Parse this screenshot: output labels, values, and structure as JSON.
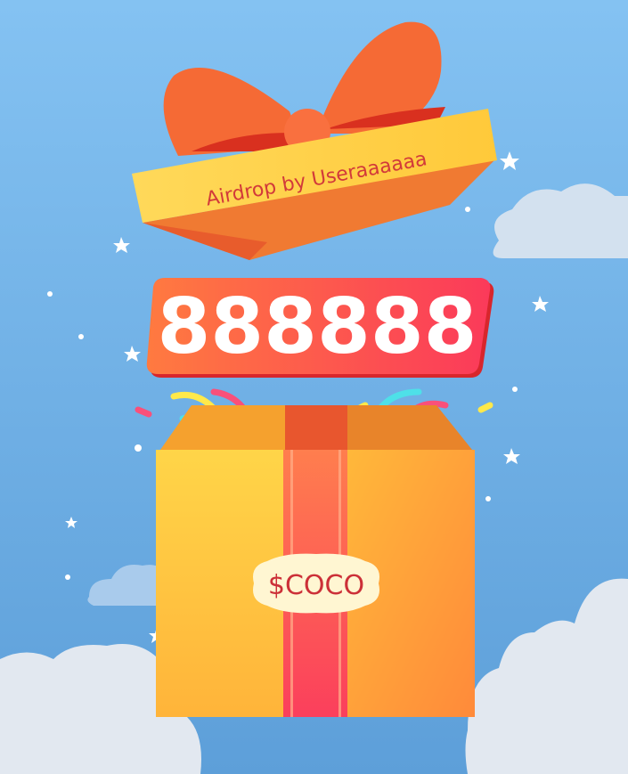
{
  "gift": {
    "lid_label": "Airdrop by Useraaaaaa",
    "amount": "888888",
    "token": "$COCO"
  },
  "icons": [
    "bow-icon",
    "gift-box-icon",
    "star-icon",
    "confetti-icon",
    "cloud-icon"
  ],
  "colors": {
    "sky_top": "#84c2f2",
    "sky_bottom": "#5d9fd9",
    "plate": "#fb4a57",
    "box": "#ffbd3a",
    "ribbon": "#fb6a4e",
    "label_text": "#cc3038"
  }
}
